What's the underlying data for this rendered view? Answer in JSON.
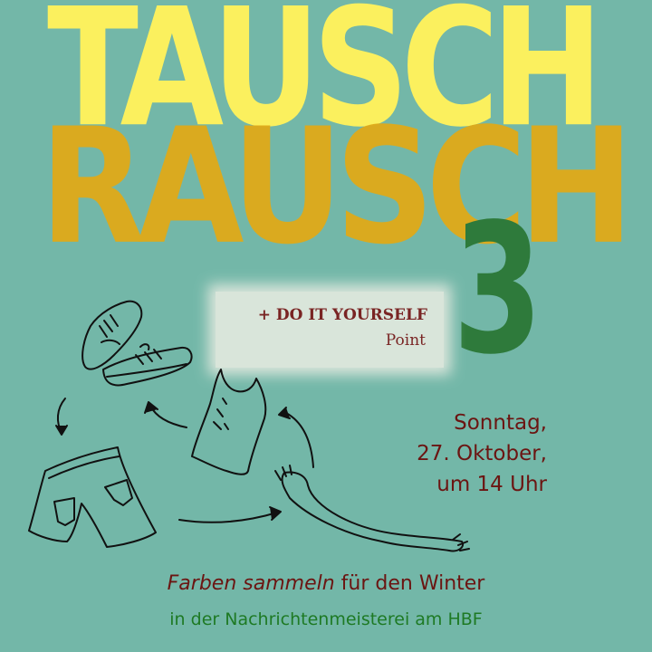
{
  "title": {
    "line1": "TAUSCH",
    "line2": "RAUSCH",
    "number": "3"
  },
  "diy": {
    "title": "+ DO IT YOURSELF",
    "subtitle": "Point"
  },
  "event": {
    "day": "Sonntag,",
    "date": "27. Oktober,",
    "time": "um 14 Uhr"
  },
  "tagline": {
    "italic": "Farben sammeln",
    "regular": "für den Winter"
  },
  "venue": "in der Nachrichtenmeisterei am HBF",
  "colors": {
    "background": "#73b7a8",
    "tausch": "#fbf05e",
    "rausch": "#e0aa18",
    "number": "#2e7a3b",
    "text_dark_red": "#6b1512",
    "text_green": "#1e7a24"
  },
  "illustrations": [
    "sneakers-sketch",
    "tank-top-sketch",
    "shorts-sketch",
    "scarf-sketch",
    "arrow-icon"
  ]
}
